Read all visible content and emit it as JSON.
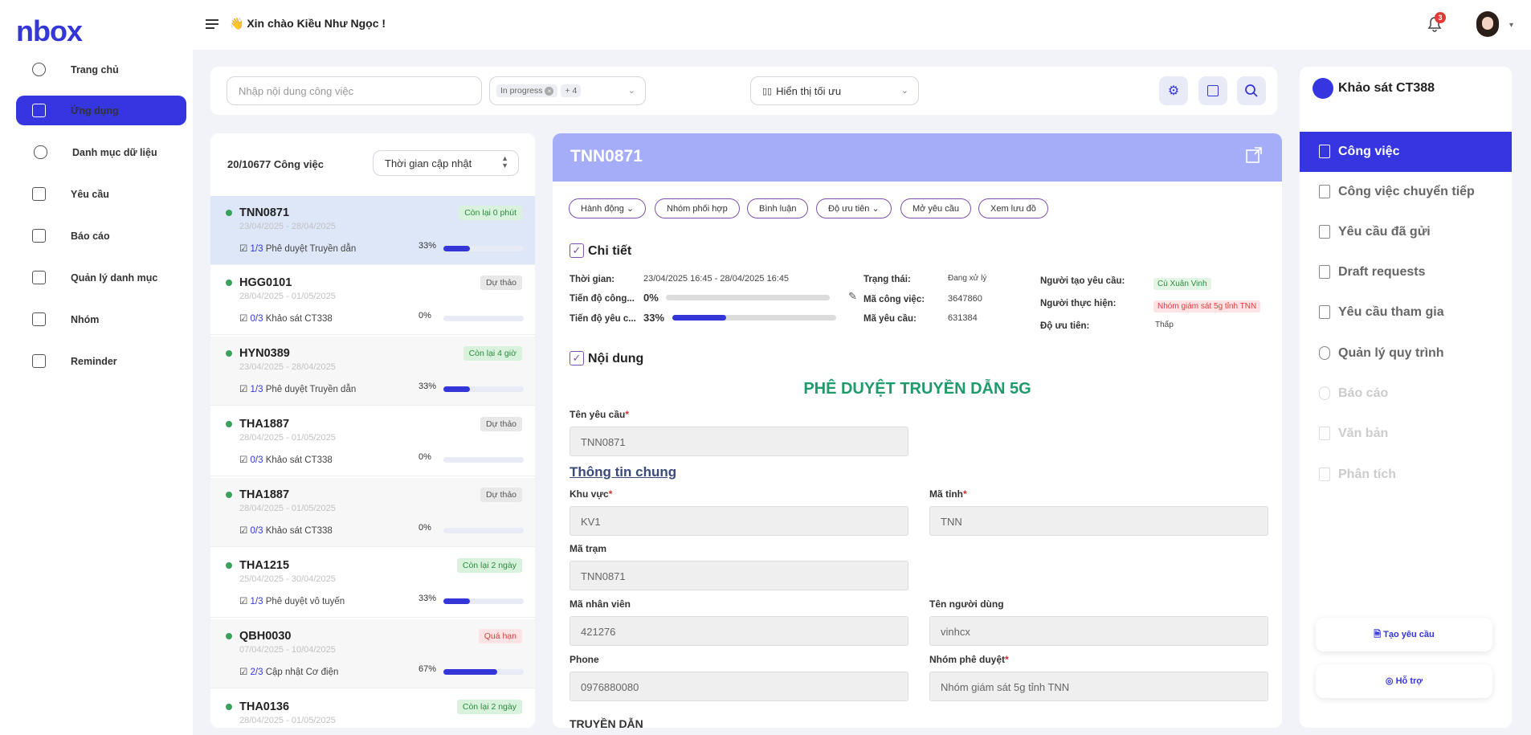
{
  "header": {
    "logo": "nbox",
    "greeting": "Xin chào Kiều Như Ngọc !",
    "notification_count": "3",
    "greeting_emoji": "👋"
  },
  "nav": {
    "items": [
      {
        "label": "Trang chủ"
      },
      {
        "label": "Ứng dụng"
      },
      {
        "label": "Danh mục dữ liệu"
      },
      {
        "label": "Yêu cầu"
      },
      {
        "label": "Báo cáo"
      },
      {
        "label": "Quản lý danh mục"
      },
      {
        "label": "Nhóm"
      },
      {
        "label": "Reminder"
      }
    ],
    "active_index": 1
  },
  "filters": {
    "search_placeholder": "Nhập nội dung công việc",
    "status_chip": "In progress",
    "more_count": "+ 4",
    "view_mode": "Hiển thị tối ưu"
  },
  "list": {
    "count_label": "20/10677 Công việc",
    "sort_label": "Thời gian cập nhật",
    "items": [
      {
        "code": "TNN0871",
        "date": "23/04/2025 - 28/04/2025",
        "progress_text": "1/3",
        "task": "Phê duyệt Truyền dẫn",
        "pct": "33%",
        "fill": 0.33,
        "status": "Còn lại 0 phút",
        "status_type": "green"
      },
      {
        "code": "HGG0101",
        "date": "28/04/2025 - 01/05/2025",
        "progress_text": "0/3",
        "task": "Khảo sát CT338",
        "pct": "0%",
        "fill": 0,
        "status": "Dự thảo",
        "status_type": "gray"
      },
      {
        "code": "HYN0389",
        "date": "23/04/2025 - 28/04/2025",
        "progress_text": "1/3",
        "task": "Phê duyệt Truyền dẫn",
        "pct": "33%",
        "fill": 0.33,
        "status": "Còn lại 4 giờ",
        "status_type": "green"
      },
      {
        "code": "THA1887",
        "date": "28/04/2025 - 01/05/2025",
        "progress_text": "0/3",
        "task": "Khảo sát CT338",
        "pct": "0%",
        "fill": 0,
        "status": "Dự thảo",
        "status_type": "gray"
      },
      {
        "code": "THA1887",
        "date": "28/04/2025 - 01/05/2025",
        "progress_text": "0/3",
        "task": "Khảo sát CT338",
        "pct": "0%",
        "fill": 0,
        "status": "Dự thảo",
        "status_type": "gray"
      },
      {
        "code": "THA1215",
        "date": "25/04/2025 - 30/04/2025",
        "progress_text": "1/3",
        "task": "Phê duyệt vô tuyến",
        "pct": "33%",
        "fill": 0.33,
        "status": "Còn lại 2 ngày",
        "status_type": "green"
      },
      {
        "code": "QBH0030",
        "date": "07/04/2025 - 10/04/2025",
        "progress_text": "2/3",
        "task": "Cập nhật Cơ điện",
        "pct": "67%",
        "fill": 0.67,
        "status": "Quá hạn",
        "status_type": "red"
      },
      {
        "code": "THA0136",
        "date": "28/04/2025 - 01/05/2025",
        "progress_text": "",
        "task": "",
        "pct": "",
        "fill": 0,
        "status": "Còn lại 2 ngày",
        "status_type": "green"
      }
    ]
  },
  "detail": {
    "code": "TNN0871",
    "actions": [
      "Hành động",
      "Nhóm phối hợp",
      "Bình luận",
      "Độ ưu tiên",
      "Mở yêu cầu",
      "Xem lưu đồ"
    ],
    "section_detail": "Chi tiết",
    "time_label": "Thời gian:",
    "time_value": "23/04/2025 16:45 - 28/04/2025 16:45",
    "work_progress_label": "Tiến độ công...",
    "work_progress_value": "0%",
    "work_progress_fill": 0,
    "req_progress_label": "Tiến độ yêu c...",
    "req_progress_value": "33%",
    "req_progress_fill": 0.33,
    "status_label": "Trạng thái:",
    "status_value": "Đang xử lý",
    "job_code_label": "Mã công việc:",
    "job_code_value": "3647860",
    "req_code_label": "Mã yêu cầu:",
    "req_code_value": "631384",
    "creator_label": "Người tạo yêu cầu:",
    "creator_value": "Cù Xuân Vinh",
    "assignee_label": "Người thực hiện:",
    "assignee_value": "Nhóm giám sát 5g tỉnh TNN",
    "priority_label": "Độ ưu tiên:",
    "priority_value": "Thấp",
    "section_content": "Nội dung",
    "form_title": "PHÊ DUYỆT TRUYỀN DẪN 5G",
    "req_name_label": "Tên yêu cầu",
    "req_name_value": "TNN0871",
    "general_info": "Thông tin chung",
    "area_label": "Khu vực",
    "area_value": "KV1",
    "province_label": "Mã tỉnh",
    "province_value": "TNN",
    "station_label": "Mã trạm",
    "station_value": "TNN0871",
    "emp_label": "Mã nhân viên",
    "emp_value": "421276",
    "user_label": "Tên người dùng",
    "user_value": "vinhcx",
    "phone_label": "Phone",
    "phone_value": "0976880080",
    "approver_label": "Nhóm phê duyệt",
    "approver_value": "Nhóm giám sát 5g tỉnh TNN",
    "next_section": "TRUYỀN DẪN"
  },
  "right": {
    "title": "Khảo sát CT388",
    "items": [
      "Công việc",
      "Công việc chuyển tiếp",
      "Yêu cầu đã gửi",
      "Draft requests",
      "Yêu cầu tham gia",
      "Quản lý quy trình",
      "Báo cáo",
      "Văn bản",
      "Phân tích"
    ],
    "create_btn": "Tạo yêu cầu",
    "support_btn": "Hỗ trợ"
  },
  "colors": {
    "accent": "#3536e0",
    "header_band": "#a5adf8",
    "form_title": "#1f9a6a"
  }
}
